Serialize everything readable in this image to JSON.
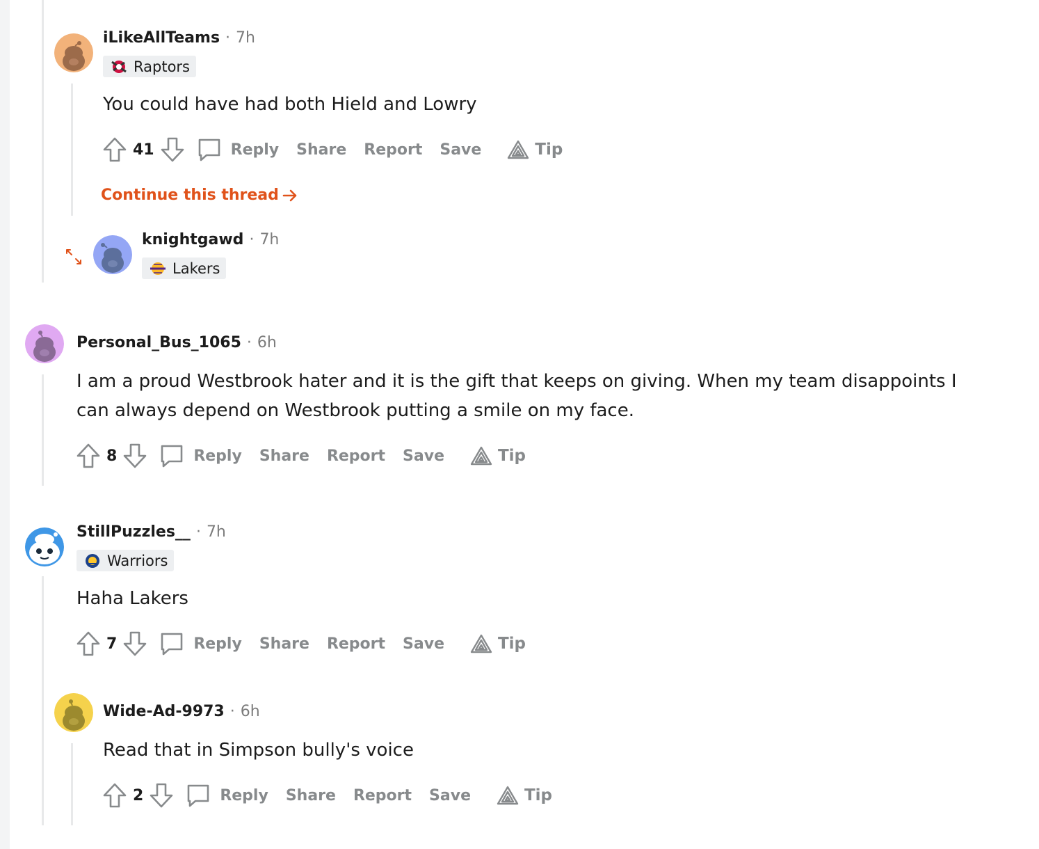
{
  "continue_thread": {
    "label": "Continue this thread",
    "color": "#e0521a"
  },
  "actions": {
    "reply": "Reply",
    "share": "Share",
    "report": "Report",
    "save": "Save",
    "tip": "Tip"
  },
  "comments": [
    {
      "username": "iLikeAllTeams",
      "time": "7h",
      "flair": "Raptors",
      "flair_icon": "raptors-logo-icon",
      "avatar_color": "#f2b27a",
      "body": "You could have had both Hield and Lowry",
      "score": "41"
    },
    {
      "username": "knightgawd",
      "time": "7h",
      "flair": "Lakers",
      "flair_icon": "lakers-logo-icon",
      "avatar_color": "#94a6f5",
      "collapsed": true
    },
    {
      "username": "Personal_Bus_1065",
      "time": "6h",
      "avatar_color": "#e0a9f2",
      "body": "I am a proud Westbrook hater and it is the gift that keeps on giving. When my team disappoints I can always depend on Westbrook putting a smile on my face.",
      "score": "8"
    },
    {
      "username": "StillPuzzles__",
      "time": "7h",
      "flair": "Warriors",
      "flair_icon": "warriors-logo-icon",
      "avatar_color": "#3f97e6",
      "body": "Haha Lakers",
      "score": "7"
    },
    {
      "username": "Wide-Ad-9973",
      "time": "6h",
      "avatar_color": "#f5d24c",
      "body": "Read that in Simpson bully's voice",
      "score": "2"
    }
  ]
}
